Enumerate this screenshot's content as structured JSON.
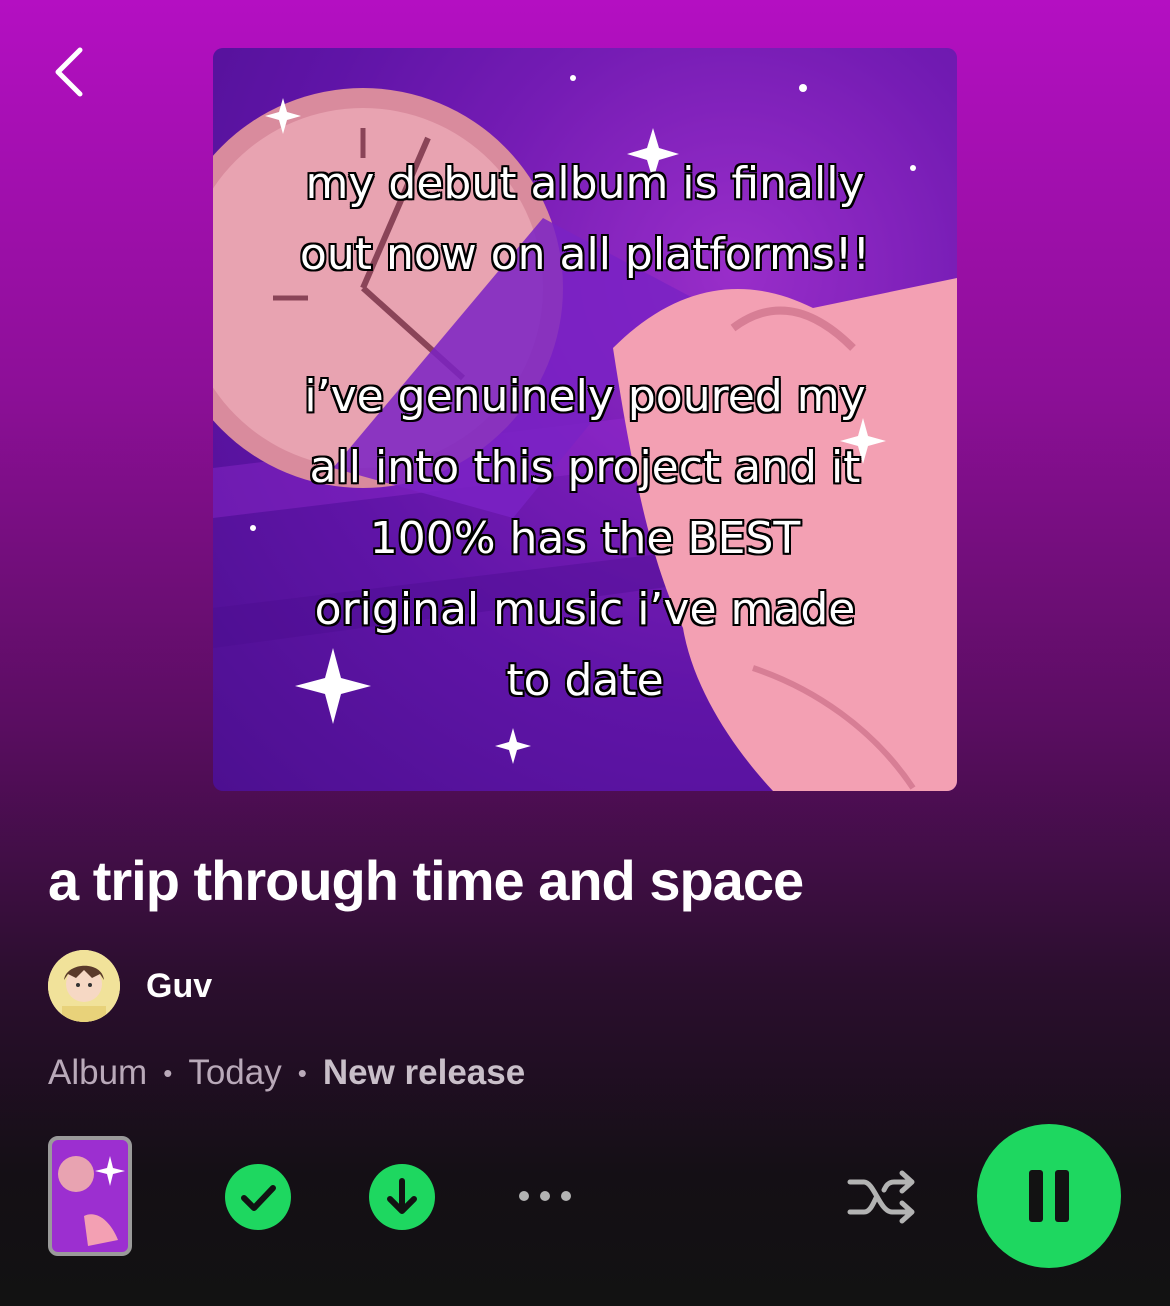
{
  "cover": {
    "caption_lines_1": [
      "my debut album is finally",
      "out now on all platforms!!"
    ],
    "caption_lines_2": [
      "i’ve genuinely poured my",
      "all into this project and it",
      "100% has the BEST",
      "original music i’ve made",
      "to date"
    ]
  },
  "album": {
    "title": "a trip through time and space",
    "artist": "Guv",
    "type": "Album",
    "date": "Today",
    "release_label": "New release"
  },
  "colors": {
    "accent": "#1ed760",
    "gradient_top": "#b40fc2",
    "background": "#121212"
  },
  "icons": {
    "back": "chevron-left-icon",
    "saved": "check-circle-icon",
    "download": "download-icon",
    "more": "more-options-icon",
    "shuffle": "shuffle-icon",
    "pause": "pause-icon"
  }
}
